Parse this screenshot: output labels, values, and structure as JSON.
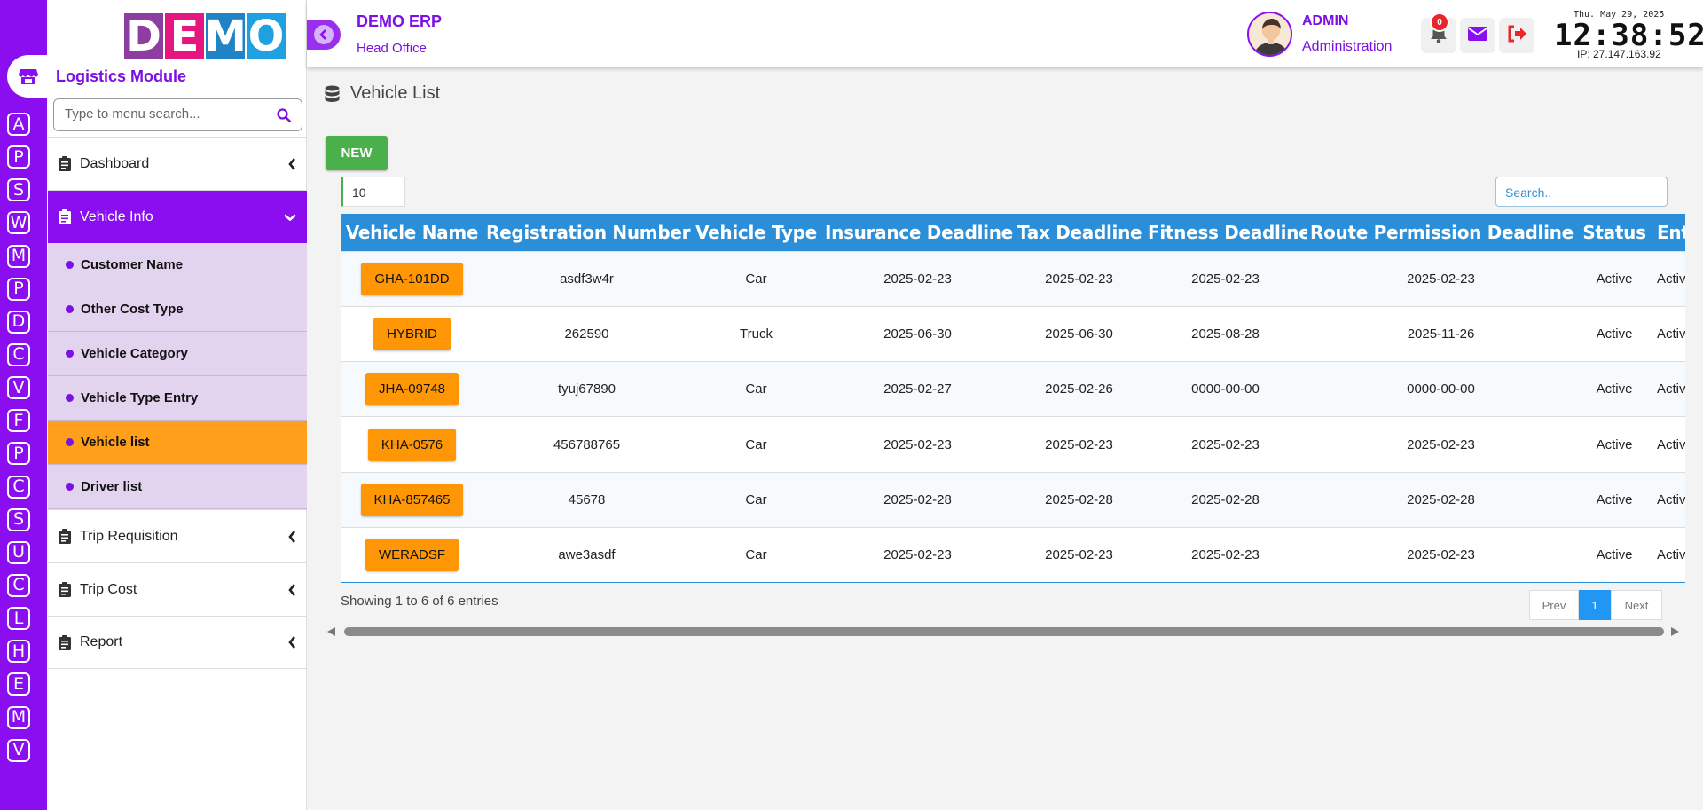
{
  "rail": {
    "letters": [
      "A",
      "P",
      "S",
      "W",
      "M",
      "P",
      "D",
      "C",
      "V",
      "F",
      "P",
      "C",
      "S",
      "U",
      "C",
      "L",
      "H",
      "E",
      "M",
      "V"
    ]
  },
  "logo": {
    "letters": [
      "D",
      "E",
      "M",
      "O"
    ],
    "colors": [
      "#8e3ea0",
      "#e5177e",
      "#1f83c6",
      "#1fa0e0"
    ]
  },
  "sidebar": {
    "module_title": "Logistics Module",
    "search_placeholder": "Type to menu search...",
    "items": [
      {
        "label": "Dashboard"
      },
      {
        "label": "Vehicle Info",
        "sub": [
          "Customer Name",
          "Other Cost Type",
          "Vehicle Category",
          "Vehicle Type Entry",
          "Vehicle list",
          "Driver list"
        ]
      },
      {
        "label": "Trip Requisition"
      },
      {
        "label": "Trip Cost"
      },
      {
        "label": "Report"
      }
    ]
  },
  "header": {
    "title": "DEMO ERP",
    "subtitle": "Head Office",
    "user_name": "ADMIN",
    "user_role": "Administration",
    "notification_count": "0",
    "date": "Thu. May 29, 2025",
    "time": "12:38:52",
    "ip": "IP: 27.147.163.92"
  },
  "page": {
    "title": "Vehicle List",
    "new_label": "NEW",
    "page_length": "10",
    "search_placeholder": "Search..",
    "showing": "Showing 1 to 6 of 6 entries",
    "prev_label": "Prev",
    "current_page": "1",
    "next_label": "Next"
  },
  "table": {
    "columns": [
      "Vehicle Name",
      "Registration Number",
      "Vehicle Type",
      "Insurance Deadline",
      "Tax Deadline",
      "Fitness Deadline",
      "Route Permission Deadline",
      "Status",
      "Entry"
    ],
    "rows": [
      [
        "GHA-101DD",
        "asdf3w4r",
        "Car",
        "2025-02-23",
        "2025-02-23",
        "2025-02-23",
        "2025-02-23",
        "Active",
        "Active"
      ],
      [
        "HYBRID",
        "262590",
        "Truck",
        "2025-06-30",
        "2025-06-30",
        "2025-08-28",
        "2025-11-26",
        "Active",
        "Active"
      ],
      [
        "JHA-09748",
        "tyuj67890",
        "Car",
        "2025-02-27",
        "2025-02-26",
        "0000-00-00",
        "0000-00-00",
        "Active",
        "Active"
      ],
      [
        "KHA-0576",
        "456788765",
        "Car",
        "2025-02-23",
        "2025-02-23",
        "2025-02-23",
        "2025-02-23",
        "Active",
        "Active"
      ],
      [
        "KHA-857465",
        "45678",
        "Car",
        "2025-02-28",
        "2025-02-28",
        "2025-02-28",
        "2025-02-28",
        "Active",
        "Active"
      ],
      [
        "WERADSF",
        "awe3asdf",
        "Car",
        "2025-02-23",
        "2025-02-23",
        "2025-02-23",
        "2025-02-23",
        "Active",
        "Active"
      ]
    ]
  },
  "icons": {
    "home": "store-icon",
    "search": "search-icon",
    "menu_item": "clipboard-icon",
    "collapse": "chevron-left-icon",
    "notifications": "bell-icon",
    "mail": "envelope-icon",
    "logout": "sign-out-icon",
    "page": "database-icon"
  },
  "colors": {
    "brand_purple": "#8a0ef0",
    "active_orange": "#ff9f1c",
    "table_header": "#2b8ed8",
    "new_button": "#49b04b",
    "badge_red": "#e8272d"
  }
}
